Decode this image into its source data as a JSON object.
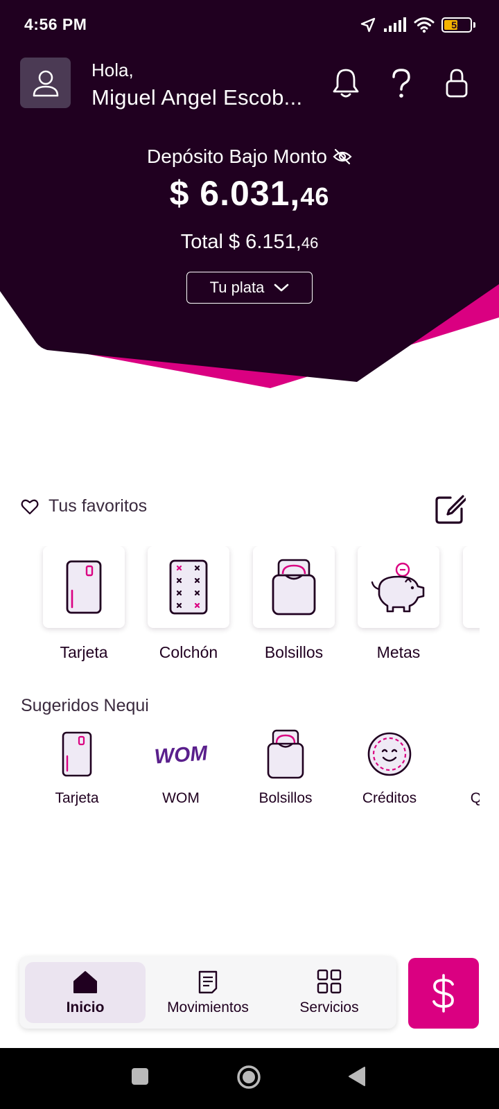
{
  "status_bar": {
    "time": "4:56 PM",
    "battery": "52",
    "battery_level": 0.52,
    "icons": [
      "location-arrow-icon",
      "signal-icon",
      "wifi-icon",
      "battery-icon"
    ]
  },
  "colors": {
    "hero": "#200020",
    "accent": "#da0081",
    "nav_active_bg": "#ebe4f0",
    "battery_fill": "#f4b400"
  },
  "header": {
    "greeting": "Hola,",
    "user_name": "Miguel Angel Escob...",
    "icons": [
      "bell-icon",
      "help-icon",
      "lock-icon"
    ]
  },
  "balance": {
    "label": "Depósito Bajo Monto",
    "amount_main": "$ 6.031,",
    "amount_decimals": "46",
    "total_main": "Total $ 6.151,",
    "total_decimals": "46",
    "dropdown_label": "Tu plata"
  },
  "favorites": {
    "title": "Tus favoritos",
    "items": [
      {
        "label": "Tarjeta",
        "icon": "card-icon"
      },
      {
        "label": "Colchón",
        "icon": "mattress-icon"
      },
      {
        "label": "Bolsillos",
        "icon": "pockets-icon"
      },
      {
        "label": "Metas",
        "icon": "piggy-bank-icon"
      }
    ]
  },
  "suggested": {
    "title": "Sugeridos Nequi",
    "items": [
      {
        "label": "Tarjeta",
        "icon": "card-icon"
      },
      {
        "label": "WOM",
        "icon": "wom-logo"
      },
      {
        "label": "Bolsillos",
        "icon": "pockets-icon"
      },
      {
        "label": "Créditos",
        "icon": "smiley-coin-icon"
      },
      {
        "label": "QR N",
        "icon": "qr-icon"
      }
    ],
    "logo_text": "WOM"
  },
  "bottom_nav": {
    "items": [
      {
        "label": "Inicio",
        "icon": "home-icon",
        "active": true
      },
      {
        "label": "Movimientos",
        "icon": "document-icon",
        "active": false
      },
      {
        "label": "Servicios",
        "icon": "grid-icon",
        "active": false
      }
    ],
    "fab_icon": "dollar-icon"
  },
  "system_nav": [
    "recent-apps-icon",
    "home-circle-icon",
    "back-icon"
  ]
}
